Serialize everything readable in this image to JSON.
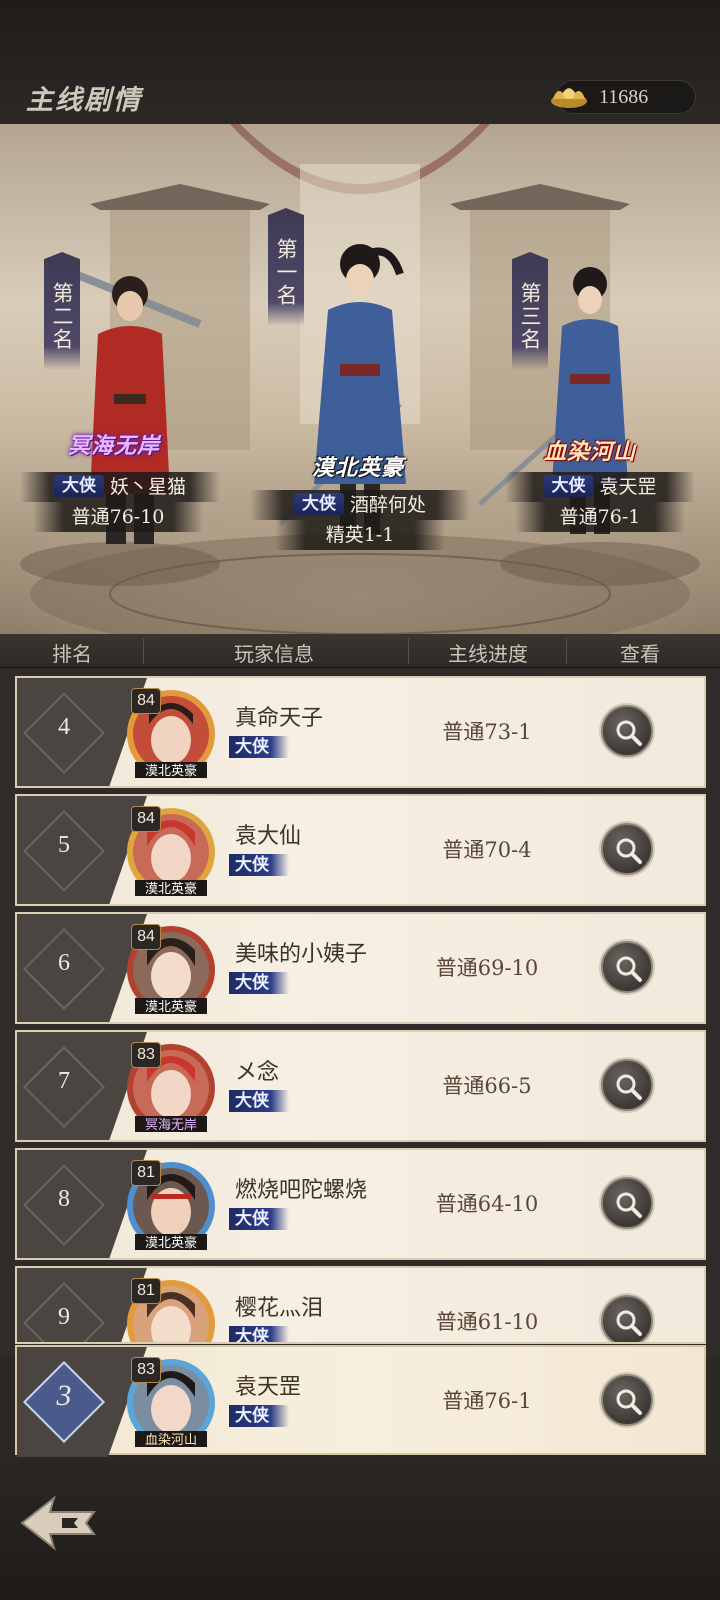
{
  "header": {
    "title": "主线剧情",
    "currency": "11686"
  },
  "podium": [
    {
      "rank_label": "第二名",
      "guild": "冥海无岸",
      "title_badge": "大侠",
      "name": "妖丶星猫",
      "progress": "普通76-10"
    },
    {
      "rank_label": "第一名",
      "guild": "漠北英豪",
      "title_badge": "大侠",
      "name": "酒醉何处",
      "progress": "精英1-1"
    },
    {
      "rank_label": "第三名",
      "guild": "血染河山",
      "title_badge": "大侠",
      "name": "袁天罡",
      "progress": "普通76-1"
    }
  ],
  "columns": {
    "rank": "排名",
    "info": "玩家信息",
    "progress": "主线进度",
    "view": "查看"
  },
  "rows": [
    {
      "rank": "4",
      "level": "84",
      "name": "真命天子",
      "badge": "大侠",
      "progress": "普通73-1"
    },
    {
      "rank": "5",
      "level": "84",
      "name": "袁大仙",
      "badge": "大侠",
      "progress": "普通70-4"
    },
    {
      "rank": "6",
      "level": "84",
      "name": "美味的小姨子",
      "badge": "大侠",
      "progress": "普通69-10"
    },
    {
      "rank": "7",
      "level": "83",
      "name": "メ念",
      "badge": "大侠",
      "progress": "普通66-5"
    },
    {
      "rank": "8",
      "level": "81",
      "name": "燃烧吧陀螺烧",
      "badge": "大侠",
      "progress": "普通64-10"
    },
    {
      "rank": "9",
      "level": "81",
      "name": "樱花灬泪",
      "badge": "大侠",
      "progress": "普通61-10"
    }
  ],
  "self": {
    "rank": "3",
    "level": "83",
    "name": "袁天罡",
    "badge": "大侠",
    "progress": "普通76-1"
  }
}
